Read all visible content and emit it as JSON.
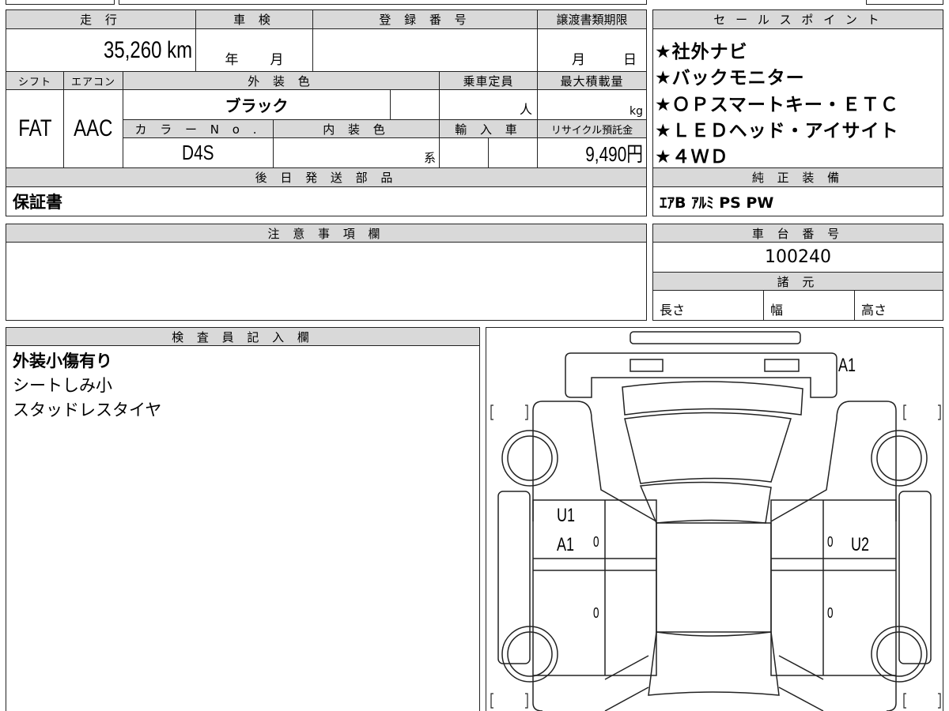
{
  "top": {
    "mileage_h": "走 行",
    "shaken_h": "車 検",
    "reg_h": "登 録 番 号",
    "transfer_h": "譲渡書類期限",
    "mileage": "35,260 km",
    "shaken_year": "年",
    "shaken_month": "月",
    "transfer_month": "月",
    "transfer_day": "日"
  },
  "row2": {
    "shift_h": "シフト",
    "ac_h": "エアコン",
    "color_h": "外 装 色",
    "capacity_h": "乗車定員",
    "load_h": "最大積載量",
    "shift": "FAT",
    "ac": "AAC",
    "color": "ブラック",
    "capacity_unit": "人",
    "load_unit": "kg"
  },
  "row3": {
    "colorno_h": "カ ラ ー N o .",
    "interior_h": "内 装 色",
    "import_h": "輸 入 車",
    "recycle_h": "リサイクル預託金",
    "colorno": "D4S",
    "interior_unit": "系",
    "recycle": "9,490円"
  },
  "later": {
    "header": "後 日 発 送 部 品",
    "value": "保証書"
  },
  "sales": {
    "header": "セ ー ル ス ポ イ ン ト",
    "points": [
      "★社外ナビ",
      "★バックモニター",
      "★ＯＰスマートキー・ＥＴＣ",
      "★ＬＥＤヘッド・アイサイト",
      "★４ＷＤ"
    ]
  },
  "equipment": {
    "header": "純 正 装 備",
    "value": "ｴｱB ｱﾙﾐ PS PW"
  },
  "notes": {
    "header": "注 意 事 項 欄"
  },
  "chassis": {
    "header": "車 台 番 号",
    "value": "100240"
  },
  "specs": {
    "header": "諸 元",
    "length": "長さ",
    "width": "幅",
    "height": "高さ"
  },
  "inspector": {
    "header": "検 査 員 記 入 欄",
    "lines": [
      "外装小傷有り",
      "シートしみ小",
      "スタッドレスタイヤ"
    ]
  },
  "diagram": {
    "marks": {
      "front": "A1",
      "left_front_door": "U1",
      "left_front_door_2": "A1",
      "right_front_door": "U2",
      "zero": "0"
    }
  }
}
